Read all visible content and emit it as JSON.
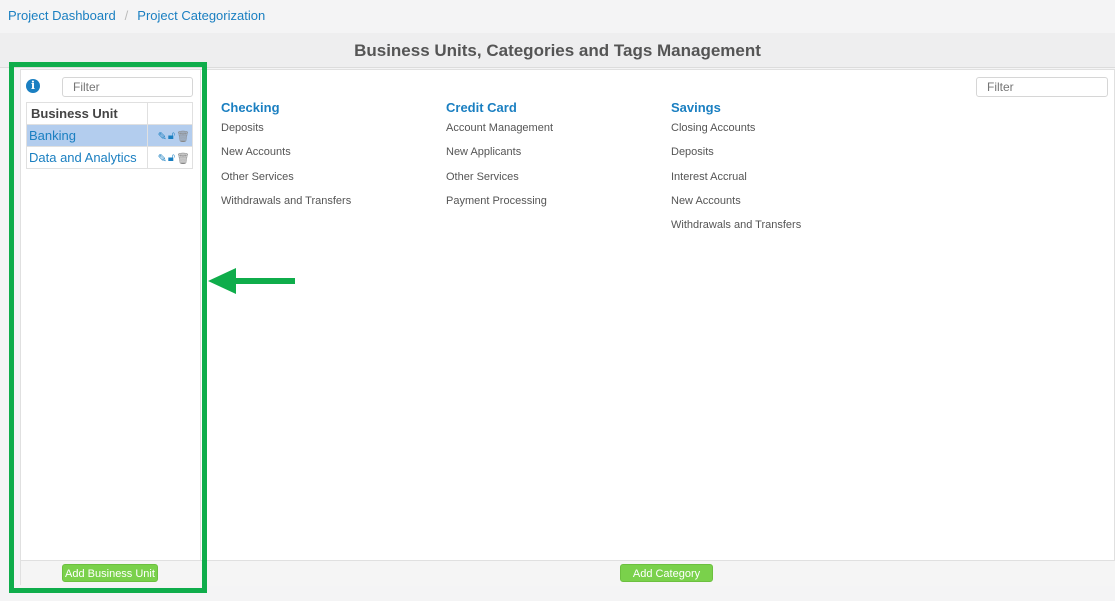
{
  "breadcrumb": {
    "items": [
      "Project Dashboard",
      "Project Categorization"
    ],
    "separator": "/"
  },
  "page_title": "Business Units, Categories and Tags Management",
  "left_panel": {
    "info_icon": "info-circle-icon",
    "filter_placeholder": "Filter",
    "table_header": "Business Unit",
    "rows": [
      {
        "name": "Banking",
        "selected": true
      },
      {
        "name": "Data and Analytics",
        "selected": false
      }
    ],
    "action_icons": [
      "pencil-icon",
      "unlock-icon",
      "trash-icon"
    ],
    "add_button": "Add Business Unit"
  },
  "right_panel": {
    "filter_placeholder": "Filter",
    "categories": [
      {
        "title": "Checking",
        "items": [
          "Deposits",
          "New Accounts",
          "Other Services",
          "Withdrawals and Transfers"
        ]
      },
      {
        "title": "Credit Card",
        "items": [
          "Account Management",
          "New Applicants",
          "Other Services",
          "Payment Processing"
        ]
      },
      {
        "title": "Savings",
        "items": [
          "Closing Accounts",
          "Deposits",
          "Interest Accrual",
          "New Accounts",
          "Withdrawals and Transfers"
        ]
      }
    ],
    "add_button": "Add Category"
  },
  "colors": {
    "link": "#1a7fc1",
    "highlight_border": "#0fad4b",
    "button_green": "#7ad14b",
    "selected_row": "#b3cdee"
  }
}
